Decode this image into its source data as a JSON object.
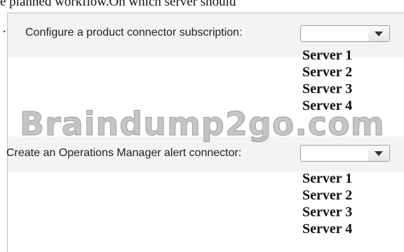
{
  "top_text": "e planned workflow.On which server should",
  "stray_mark": ".",
  "question1": {
    "label": "Configure a product connector subscription:",
    "selected": "",
    "options": [
      "Server 1",
      "Server 2",
      "Server 3",
      "Server 4"
    ]
  },
  "question2": {
    "label": "Create an Operations Manager alert connector:",
    "selected": "",
    "options": [
      "Server 1",
      "Server 2",
      "Server 3",
      "Server 4"
    ]
  },
  "watermark": "Braindump2go.com",
  "icons": {
    "dropdown_arrow": "chevron-down-icon"
  }
}
